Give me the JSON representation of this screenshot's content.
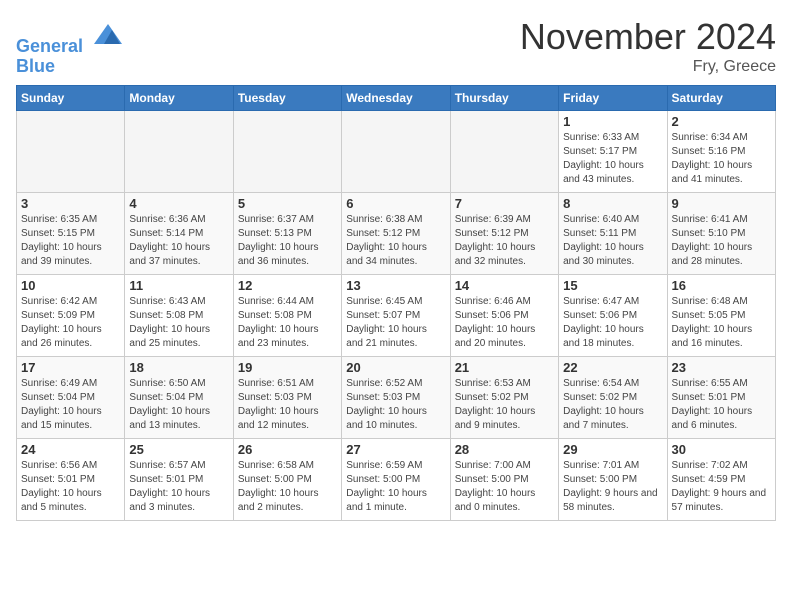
{
  "header": {
    "logo_line1": "General",
    "logo_line2": "Blue",
    "month": "November 2024",
    "location": "Fry, Greece"
  },
  "weekdays": [
    "Sunday",
    "Monday",
    "Tuesday",
    "Wednesday",
    "Thursday",
    "Friday",
    "Saturday"
  ],
  "weeks": [
    [
      {
        "day": "",
        "empty": true
      },
      {
        "day": "",
        "empty": true
      },
      {
        "day": "",
        "empty": true
      },
      {
        "day": "",
        "empty": true
      },
      {
        "day": "",
        "empty": true
      },
      {
        "day": "1",
        "sunrise": "6:33 AM",
        "sunset": "5:17 PM",
        "daylight": "10 hours and 43 minutes."
      },
      {
        "day": "2",
        "sunrise": "6:34 AM",
        "sunset": "5:16 PM",
        "daylight": "10 hours and 41 minutes."
      }
    ],
    [
      {
        "day": "3",
        "sunrise": "6:35 AM",
        "sunset": "5:15 PM",
        "daylight": "10 hours and 39 minutes."
      },
      {
        "day": "4",
        "sunrise": "6:36 AM",
        "sunset": "5:14 PM",
        "daylight": "10 hours and 37 minutes."
      },
      {
        "day": "5",
        "sunrise": "6:37 AM",
        "sunset": "5:13 PM",
        "daylight": "10 hours and 36 minutes."
      },
      {
        "day": "6",
        "sunrise": "6:38 AM",
        "sunset": "5:12 PM",
        "daylight": "10 hours and 34 minutes."
      },
      {
        "day": "7",
        "sunrise": "6:39 AM",
        "sunset": "5:12 PM",
        "daylight": "10 hours and 32 minutes."
      },
      {
        "day": "8",
        "sunrise": "6:40 AM",
        "sunset": "5:11 PM",
        "daylight": "10 hours and 30 minutes."
      },
      {
        "day": "9",
        "sunrise": "6:41 AM",
        "sunset": "5:10 PM",
        "daylight": "10 hours and 28 minutes."
      }
    ],
    [
      {
        "day": "10",
        "sunrise": "6:42 AM",
        "sunset": "5:09 PM",
        "daylight": "10 hours and 26 minutes."
      },
      {
        "day": "11",
        "sunrise": "6:43 AM",
        "sunset": "5:08 PM",
        "daylight": "10 hours and 25 minutes."
      },
      {
        "day": "12",
        "sunrise": "6:44 AM",
        "sunset": "5:08 PM",
        "daylight": "10 hours and 23 minutes."
      },
      {
        "day": "13",
        "sunrise": "6:45 AM",
        "sunset": "5:07 PM",
        "daylight": "10 hours and 21 minutes."
      },
      {
        "day": "14",
        "sunrise": "6:46 AM",
        "sunset": "5:06 PM",
        "daylight": "10 hours and 20 minutes."
      },
      {
        "day": "15",
        "sunrise": "6:47 AM",
        "sunset": "5:06 PM",
        "daylight": "10 hours and 18 minutes."
      },
      {
        "day": "16",
        "sunrise": "6:48 AM",
        "sunset": "5:05 PM",
        "daylight": "10 hours and 16 minutes."
      }
    ],
    [
      {
        "day": "17",
        "sunrise": "6:49 AM",
        "sunset": "5:04 PM",
        "daylight": "10 hours and 15 minutes."
      },
      {
        "day": "18",
        "sunrise": "6:50 AM",
        "sunset": "5:04 PM",
        "daylight": "10 hours and 13 minutes."
      },
      {
        "day": "19",
        "sunrise": "6:51 AM",
        "sunset": "5:03 PM",
        "daylight": "10 hours and 12 minutes."
      },
      {
        "day": "20",
        "sunrise": "6:52 AM",
        "sunset": "5:03 PM",
        "daylight": "10 hours and 10 minutes."
      },
      {
        "day": "21",
        "sunrise": "6:53 AM",
        "sunset": "5:02 PM",
        "daylight": "10 hours and 9 minutes."
      },
      {
        "day": "22",
        "sunrise": "6:54 AM",
        "sunset": "5:02 PM",
        "daylight": "10 hours and 7 minutes."
      },
      {
        "day": "23",
        "sunrise": "6:55 AM",
        "sunset": "5:01 PM",
        "daylight": "10 hours and 6 minutes."
      }
    ],
    [
      {
        "day": "24",
        "sunrise": "6:56 AM",
        "sunset": "5:01 PM",
        "daylight": "10 hours and 5 minutes."
      },
      {
        "day": "25",
        "sunrise": "6:57 AM",
        "sunset": "5:01 PM",
        "daylight": "10 hours and 3 minutes."
      },
      {
        "day": "26",
        "sunrise": "6:58 AM",
        "sunset": "5:00 PM",
        "daylight": "10 hours and 2 minutes."
      },
      {
        "day": "27",
        "sunrise": "6:59 AM",
        "sunset": "5:00 PM",
        "daylight": "10 hours and 1 minute."
      },
      {
        "day": "28",
        "sunrise": "7:00 AM",
        "sunset": "5:00 PM",
        "daylight": "10 hours and 0 minutes."
      },
      {
        "day": "29",
        "sunrise": "7:01 AM",
        "sunset": "5:00 PM",
        "daylight": "9 hours and 58 minutes."
      },
      {
        "day": "30",
        "sunrise": "7:02 AM",
        "sunset": "4:59 PM",
        "daylight": "9 hours and 57 minutes."
      }
    ]
  ]
}
